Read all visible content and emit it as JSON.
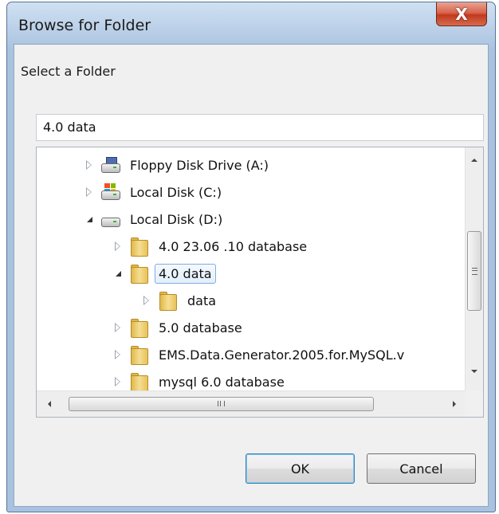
{
  "window": {
    "title": "Browse for Folder",
    "close_glyph": "X"
  },
  "dialog": {
    "instruction": "Select a Folder",
    "folder_value": "4.0 data"
  },
  "tree": {
    "items": [
      {
        "label": "Floppy Disk Drive (A:)",
        "icon": "floppy-drive-icon",
        "expander": "collapsed"
      },
      {
        "label": "Local Disk (C:)",
        "icon": "system-drive-icon",
        "expander": "collapsed"
      },
      {
        "label": "Local Disk (D:)",
        "icon": "hard-drive-icon",
        "expander": "expanded"
      },
      {
        "label": "4.0 23.06 .10 database",
        "icon": "folder-icon",
        "expander": "collapsed"
      },
      {
        "label": "4.0 data",
        "icon": "folder-icon",
        "expander": "expanded",
        "selected": true
      },
      {
        "label": "data",
        "icon": "folder-icon",
        "expander": "collapsed"
      },
      {
        "label": "5.0 database",
        "icon": "folder-icon",
        "expander": "collapsed"
      },
      {
        "label": "EMS.Data.Generator.2005.for.MySQL.v",
        "icon": "folder-icon",
        "expander": "collapsed"
      },
      {
        "label": "mysql 6.0 database",
        "icon": "folder-icon",
        "expander": "collapsed"
      }
    ]
  },
  "scrollbars": {
    "vertical_grip": "≡",
    "horizontal_grip": "III"
  },
  "buttons": {
    "ok": "OK",
    "cancel": "Cancel"
  },
  "colors": {
    "selection_border": "#84acdd",
    "close_button": "#c2391d",
    "frame": "#a9c2df"
  }
}
